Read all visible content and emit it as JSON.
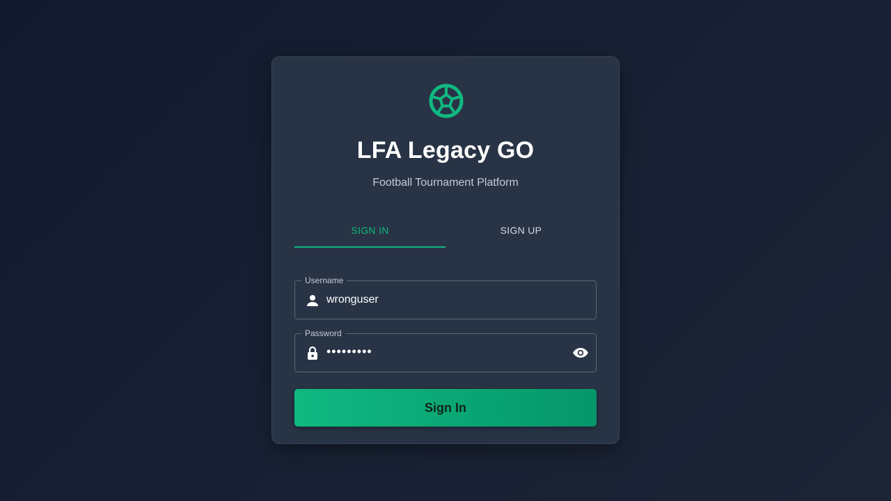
{
  "app": {
    "title": "LFA Legacy GO",
    "subtitle": "Football Tournament Platform",
    "logo_icon": "soccer-ball-icon",
    "accent_color": "#10b981"
  },
  "tabs": [
    {
      "label": "SIGN IN",
      "active": true
    },
    {
      "label": "SIGN UP",
      "active": false
    }
  ],
  "form": {
    "username": {
      "label": "Username",
      "value": "wronguser",
      "icon": "person-icon"
    },
    "password": {
      "label": "Password",
      "masked_value": "•••••••••",
      "icon": "lock-icon",
      "toggle_icon": "eye-icon"
    },
    "submit_label": "Sign In"
  }
}
